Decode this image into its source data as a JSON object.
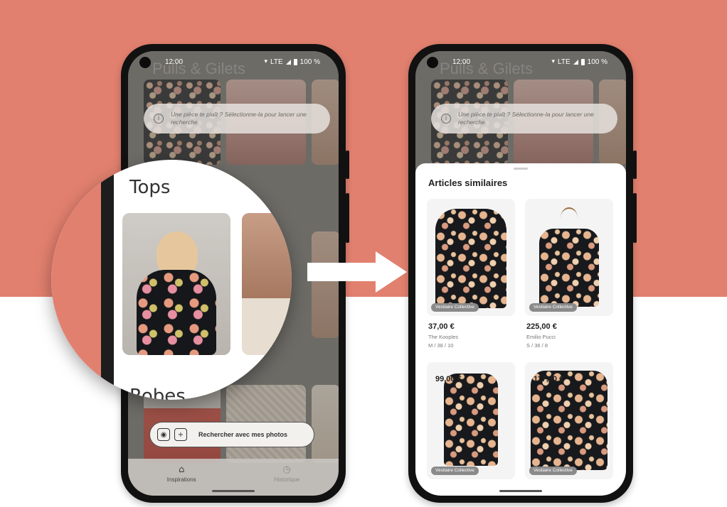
{
  "left_phone": {
    "status": {
      "time": "12:00",
      "network": "LTE",
      "battery": "100 %"
    },
    "faded_section_title": "Pulls & Gilets",
    "info_banner": {
      "text": "Une pièce te plaît ? Sélectionne-la pour lancer une recherche."
    },
    "magnifier": {
      "section_title": "Tops",
      "next_section_title": "Robes"
    },
    "search_button": {
      "label": "Rechercher avec mes photos"
    },
    "nav": {
      "items": [
        {
          "label": "Inspirations"
        },
        {
          "label": "Historique"
        }
      ]
    }
  },
  "right_phone": {
    "status": {
      "time": "12:00",
      "network": "LTE",
      "battery": "100 %"
    },
    "faded_section_title": "Pulls & Gilets",
    "info_banner": {
      "text": "Une pièce te plaît ? Sélectionne-la pour lancer une recherche."
    },
    "sheet": {
      "title": "Articles similaires",
      "products": [
        {
          "tag": "Vestiaire Collective",
          "price": "37,00 €",
          "brand": "The Kooples",
          "size": "M / 38 / 10"
        },
        {
          "tag": "Vestiaire Collective",
          "price": "225,00 €",
          "brand": "Emilio Pucci",
          "size": "S / 36 / 8"
        },
        {
          "tag": "Vestiaire Collective",
          "price": "99,00 €"
        },
        {
          "tag": "Vestiaire Collective",
          "price": "117,00 €"
        }
      ]
    }
  },
  "colors": {
    "banner_salmon": "#e2806f",
    "background": "#ffffff"
  },
  "icons": {
    "info": "info-icon",
    "camera": "camera-icon",
    "gallery": "gallery-icon",
    "home": "home-icon",
    "history": "history-icon",
    "arrow": "arrow-right-icon"
  }
}
